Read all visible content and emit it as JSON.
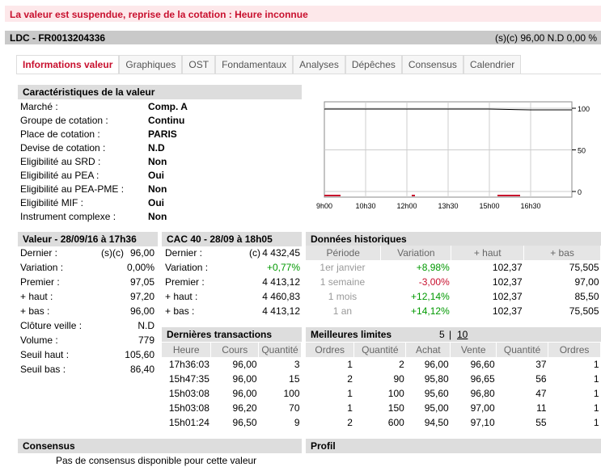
{
  "alert": "La valeur est suspendue, reprise de la cotation : Heure inconnue",
  "header": {
    "title": "LDC - FR0013204336",
    "quote": "(s)(c)  96,00  N.D  0,00 %"
  },
  "tabs": [
    "Informations valeur",
    "Graphiques",
    "OST",
    "Fondamentaux",
    "Analyses",
    "Dépêches",
    "Consensus",
    "Calendrier"
  ],
  "caract": {
    "title": "Caractéristiques de la valeur",
    "rows": [
      {
        "label": "Marché :",
        "value": "Comp. A"
      },
      {
        "label": "Groupe de cotation :",
        "value": "Continu"
      },
      {
        "label": "Place de cotation :",
        "value": "PARIS"
      },
      {
        "label": "Devise de cotation :",
        "value": "N.D"
      },
      {
        "label": "Eligibilité au SRD :",
        "value": "Non"
      },
      {
        "label": "Eligibilité au PEA :",
        "value": "Oui"
      },
      {
        "label": "Eligibilité au PEA-PME :",
        "value": "Non"
      },
      {
        "label": "Eligibilité MIF :",
        "value": "Oui"
      },
      {
        "label": "Instrument complexe :",
        "value": "Non"
      }
    ]
  },
  "chart_data": {
    "type": "line",
    "x_ticks": [
      "9h00",
      "10h30",
      "12h00",
      "13h30",
      "15h00",
      "16h30"
    ],
    "y_ticks": [
      "100",
      "50",
      "0"
    ],
    "ylim": [
      0,
      100
    ],
    "series": [
      {
        "values": [
          99,
          99,
          99,
          99,
          99,
          98,
          98
        ]
      }
    ]
  },
  "valeur": {
    "title": "Valeur - 28/09/16 à 17h36",
    "rows": [
      {
        "label": "Dernier :",
        "mid": "(s)(c)",
        "value": "96,00"
      },
      {
        "label": "Variation :",
        "mid": "",
        "value": "0,00%"
      },
      {
        "label": "Premier :",
        "mid": "",
        "value": "97,05"
      },
      {
        "label": "+ haut :",
        "mid": "",
        "value": "97,20"
      },
      {
        "label": "+ bas :",
        "mid": "",
        "value": "96,00"
      },
      {
        "label": "Clôture veille :",
        "mid": "",
        "value": "N.D"
      },
      {
        "label": "Volume :",
        "mid": "",
        "value": "779"
      },
      {
        "label": "Seuil haut :",
        "mid": "",
        "value": "105,60"
      },
      {
        "label": "Seuil bas :",
        "mid": "",
        "value": "86,40"
      }
    ]
  },
  "cac": {
    "title": "CAC 40 - 28/09 à 18h05",
    "rows": [
      {
        "label": "Dernier :",
        "mid": "(c)",
        "value": "4 432,45"
      },
      {
        "label": "Variation :",
        "mid": "",
        "value": "+0,77%"
      },
      {
        "label": "Premier :",
        "mid": "",
        "value": "4 413,12"
      },
      {
        "label": "+ haut :",
        "mid": "",
        "value": "4 460,83"
      },
      {
        "label": "+ bas :",
        "mid": "",
        "value": "4 413,12"
      }
    ]
  },
  "histo": {
    "title": "Données historiques",
    "headers": [
      "Période",
      "Variation",
      "+ haut",
      "+ bas"
    ],
    "rows": [
      [
        "1er janvier",
        "+8,98%",
        "102,37",
        "75,505"
      ],
      [
        "1 semaine",
        "-3,00%",
        "102,37",
        "97,00"
      ],
      [
        "1 mois",
        "+12,14%",
        "102,37",
        "85,50"
      ],
      [
        "1 an",
        "+14,12%",
        "102,37",
        "75,505"
      ]
    ]
  },
  "trans": {
    "title": "Dernières transactions",
    "headers": [
      "Heure",
      "Cours",
      "Quantité"
    ],
    "rows": [
      [
        "17h36:03",
        "96,00",
        "3"
      ],
      [
        "15h47:35",
        "96,00",
        "15"
      ],
      [
        "15h03:08",
        "96,00",
        "100"
      ],
      [
        "15h03:08",
        "96,20",
        "70"
      ],
      [
        "15h01:24",
        "96,50",
        "9"
      ]
    ]
  },
  "limites": {
    "title": "Meilleures limites",
    "count5": "5",
    "sep": "|",
    "count10": "10",
    "headers": [
      "Ordres",
      "Quantité",
      "Achat",
      "Vente",
      "Quantité",
      "Ordres"
    ],
    "rows": [
      [
        "1",
        "2",
        "96,00",
        "96,60",
        "37",
        "1"
      ],
      [
        "2",
        "90",
        "95,80",
        "96,65",
        "56",
        "1"
      ],
      [
        "1",
        "100",
        "95,60",
        "96,80",
        "47",
        "1"
      ],
      [
        "1",
        "150",
        "95,00",
        "97,00",
        "11",
        "1"
      ],
      [
        "2",
        "600",
        "94,50",
        "97,10",
        "55",
        "1"
      ]
    ]
  },
  "consensus": {
    "title": "Consensus",
    "text": "Pas de consensus disponible pour cette valeur"
  },
  "profil": {
    "title": "Profil"
  }
}
